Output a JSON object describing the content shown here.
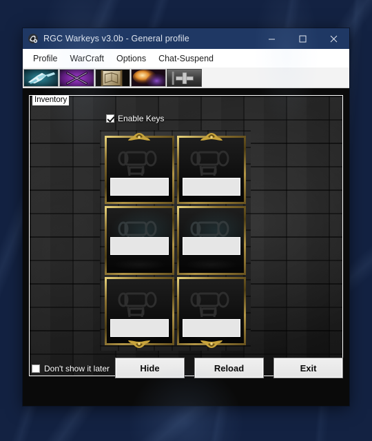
{
  "window": {
    "title": "RGC Warkeys v3.0b - General profile",
    "icon": "app-icon",
    "controls": {
      "minimize": "minimize-icon",
      "maximize": "maximize-icon",
      "close": "close-icon"
    }
  },
  "menu": {
    "items": [
      {
        "label": "Profile"
      },
      {
        "label": "WarCraft"
      },
      {
        "label": "Options"
      },
      {
        "label": "Chat-Suspend"
      }
    ]
  },
  "toolbar": {
    "buttons": [
      {
        "name": "frost-weapon-icon",
        "selected": false
      },
      {
        "name": "crossed-swords-icon",
        "selected": false
      },
      {
        "name": "scroll-map-icon",
        "selected": false
      },
      {
        "name": "fire-orb-icon",
        "selected": false
      },
      {
        "name": "metal-cross-icon",
        "selected": true
      }
    ]
  },
  "inventory": {
    "group_label": "Inventory",
    "enable_keys": {
      "label": "Enable Keys",
      "checked": true
    },
    "slots": [
      {
        "value": "",
        "placeholder": "",
        "ornament": "top",
        "tinted": false,
        "row": 1
      },
      {
        "value": "",
        "placeholder": "",
        "ornament": "top",
        "tinted": false,
        "row": 1
      },
      {
        "value": "",
        "placeholder": "",
        "ornament": "none",
        "tinted": true,
        "row": 2
      },
      {
        "value": "",
        "placeholder": "",
        "ornament": "none",
        "tinted": true,
        "row": 2
      },
      {
        "value": "",
        "placeholder": "",
        "ornament": "bottom",
        "tinted": false,
        "row": 3
      },
      {
        "value": "",
        "placeholder": "",
        "ornament": "bottom",
        "tinted": false,
        "row": 3
      }
    ]
  },
  "footer": {
    "dont_show": {
      "label": "Don't show it later",
      "checked": false
    },
    "buttons": [
      {
        "label": "Hide"
      },
      {
        "label": "Reload"
      },
      {
        "label": "Exit"
      }
    ]
  },
  "colors": {
    "titlebar": "#1f3864",
    "gold": "#b29546",
    "panel_dark": "#0a0a0a",
    "button_face": "#e8e8e8",
    "accent_text": "#ffffff"
  }
}
